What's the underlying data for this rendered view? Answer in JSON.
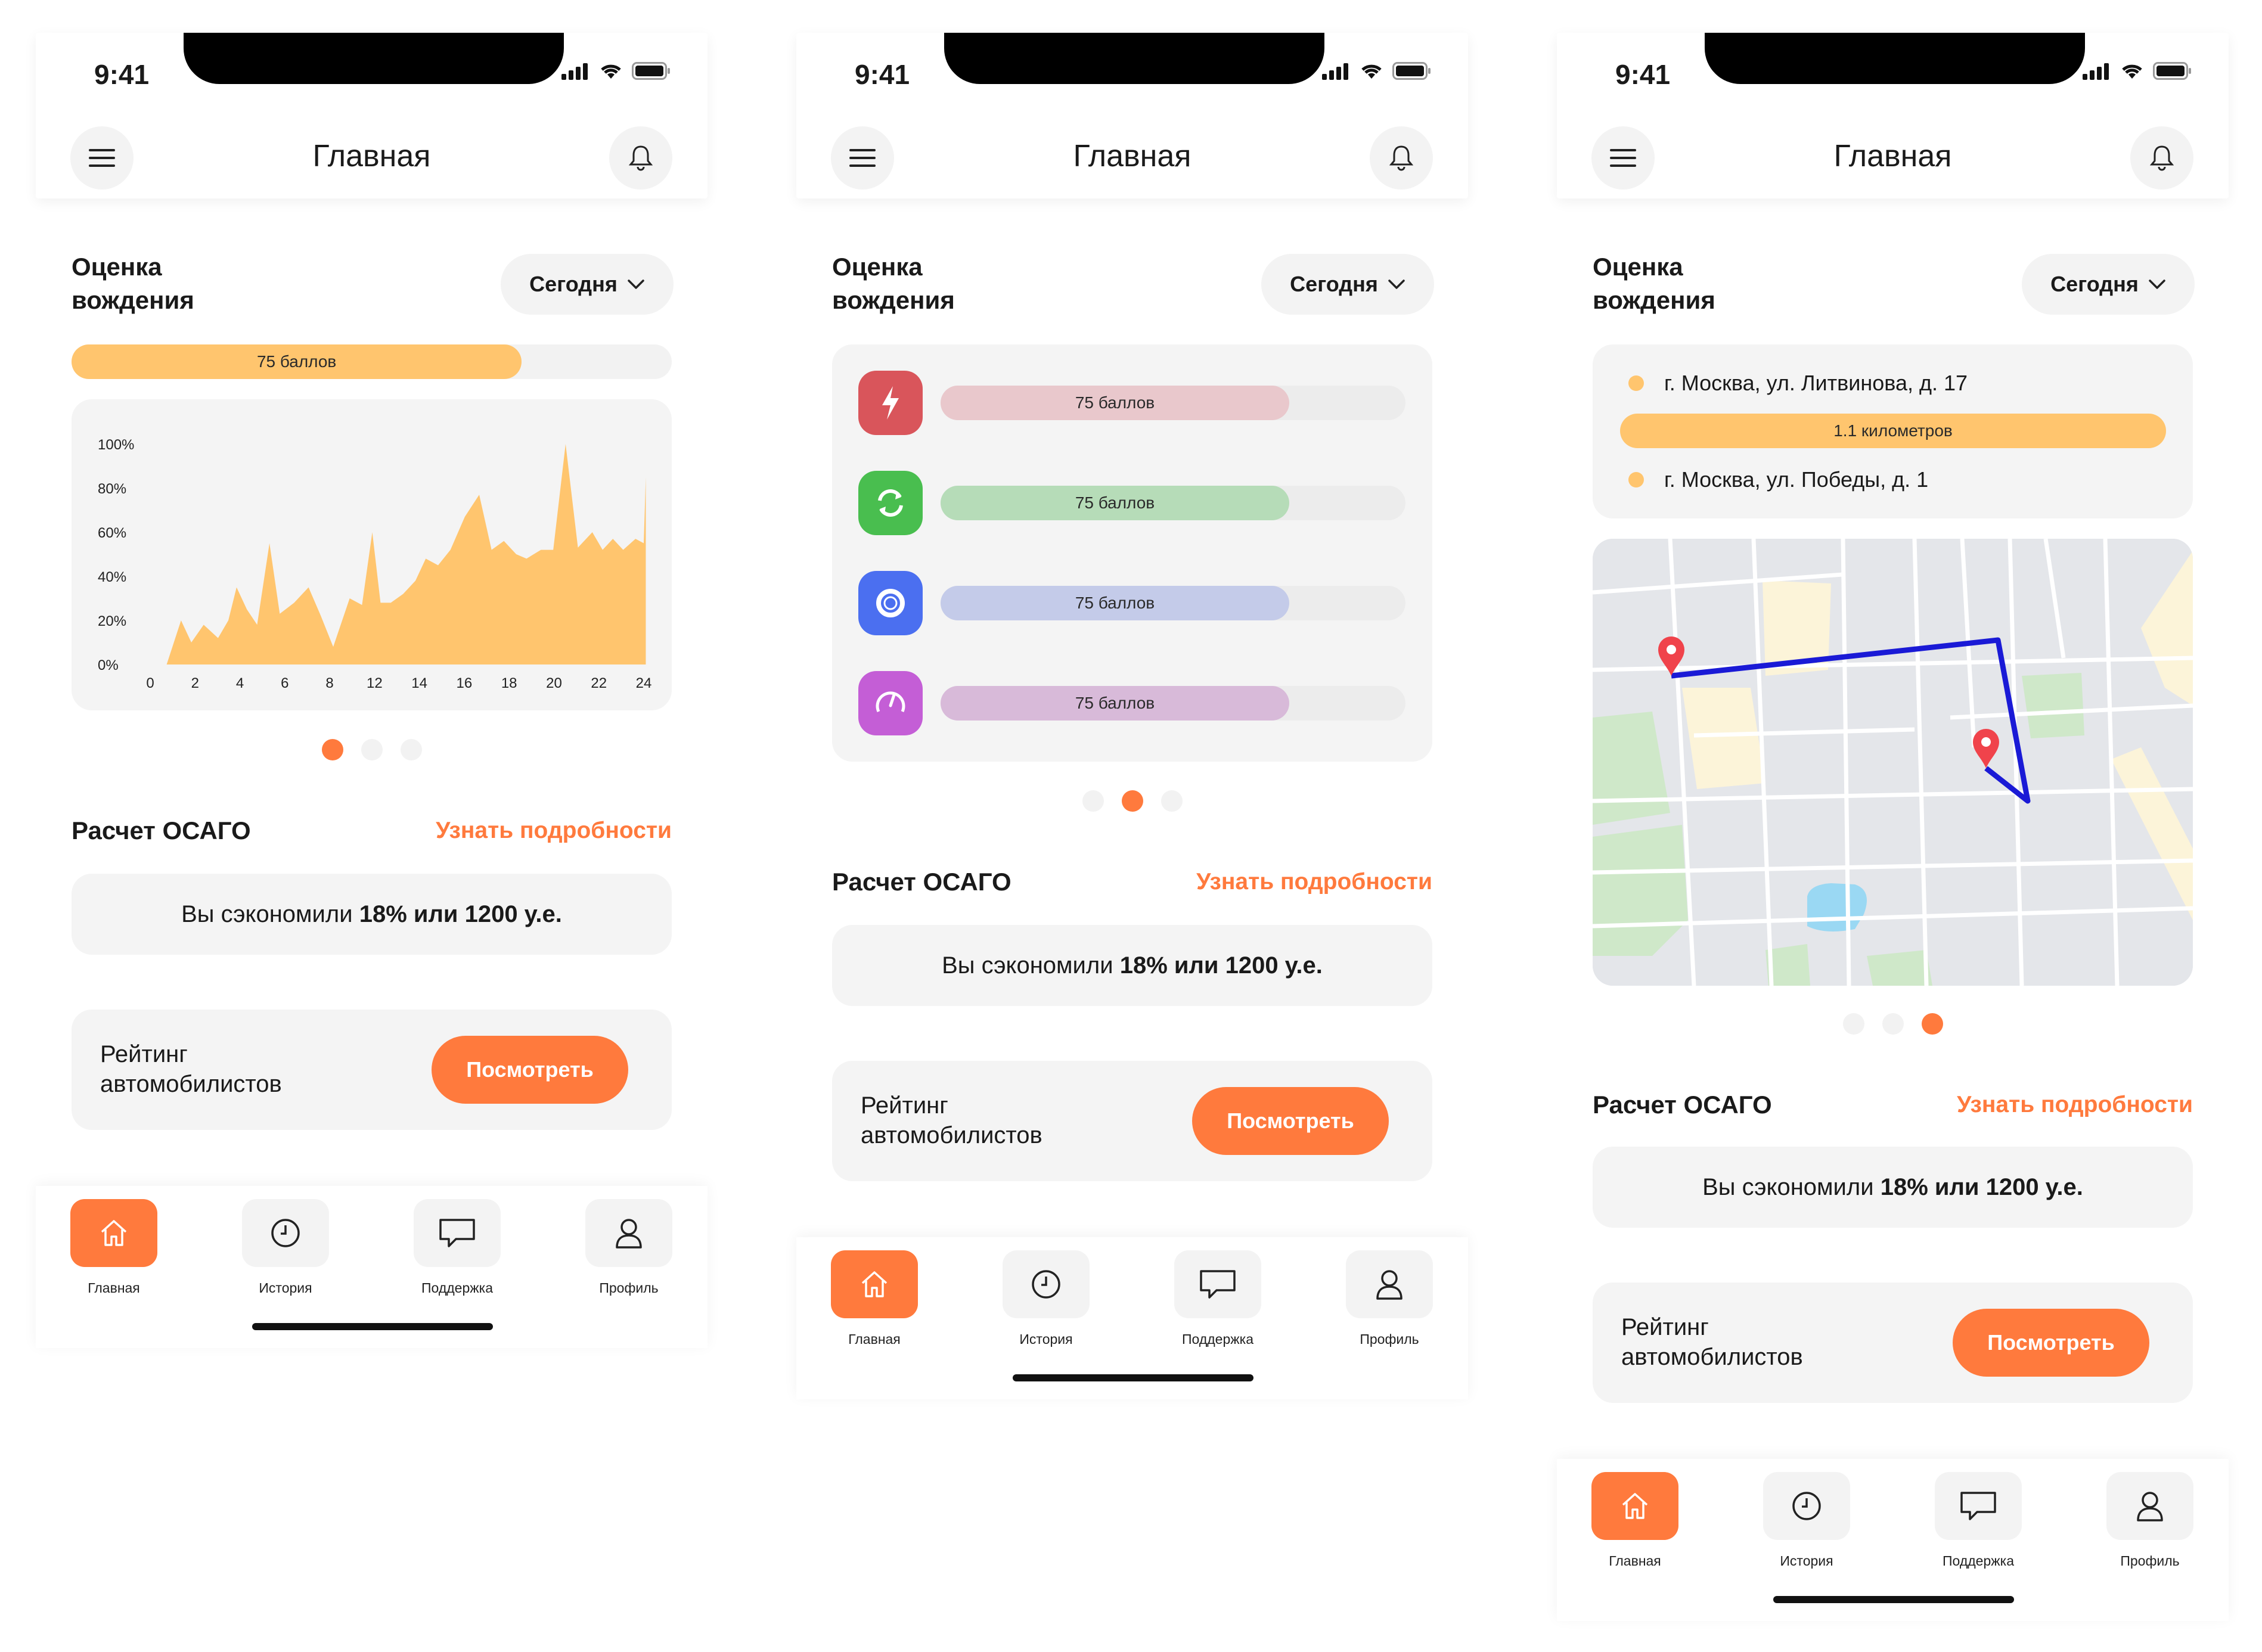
{
  "status": {
    "time": "9:41"
  },
  "header": {
    "title": "Главная"
  },
  "driving": {
    "title_line1": "Оценка",
    "title_line2": "вождения",
    "period": "Сегодня",
    "score_label": "75 баллов",
    "score_pct": 75
  },
  "chart_data": {
    "type": "area",
    "title": "",
    "xlabel": "",
    "ylabel": "",
    "x_ticks": [
      "0",
      "2",
      "4",
      "6",
      "8",
      "12",
      "14",
      "16",
      "18",
      "20",
      "22",
      "24"
    ],
    "y_ticks": [
      "0%",
      "20%",
      "40%",
      "60%",
      "80%",
      "100%"
    ],
    "ylim": [
      0,
      100
    ],
    "xlim": [
      0,
      24
    ],
    "x": [
      0,
      0.8,
      1.5,
      2.0,
      2.6,
      3.3,
      3.8,
      4.2,
      4.7,
      5.2,
      5.8,
      6.3,
      7.0,
      7.7,
      8.3,
      8.9,
      9.7,
      10.3,
      10.8,
      11.2,
      11.7,
      12.3,
      12.9,
      13.4,
      14.0,
      14.6,
      15.3,
      16.0,
      16.6,
      17.2,
      17.8,
      18.3,
      19.0,
      19.6,
      20.2,
      20.8,
      21.5,
      22.0,
      22.5,
      23.0,
      23.6,
      24.0,
      24.1
    ],
    "values": [
      0,
      0,
      20,
      10,
      18,
      12,
      20,
      35,
      25,
      18,
      55,
      23,
      28,
      35,
      22,
      8,
      30,
      27,
      60,
      28,
      28,
      32,
      38,
      48,
      45,
      52,
      67,
      77,
      52,
      56,
      50,
      48,
      52,
      52,
      102,
      53,
      60,
      52,
      57,
      52,
      57,
      55,
      85
    ],
    "fill": "#ffc56e"
  },
  "stats": {
    "items": [
      {
        "label": "75 баллов",
        "pct": 75,
        "icon": "lightning-icon",
        "icon_color": "#d9555b",
        "fill": "#e9c8cc"
      },
      {
        "label": "75 баллов",
        "pct": 75,
        "icon": "refresh-icon",
        "icon_color": "#49be4f",
        "fill": "#b6dcb8"
      },
      {
        "label": "75 баллов",
        "pct": 75,
        "icon": "target-icon",
        "icon_color": "#4b6ff0",
        "fill": "#c4cbe9"
      },
      {
        "label": "75 баллов",
        "pct": 75,
        "icon": "speedometer-icon",
        "icon_color": "#c45ed6",
        "fill": "#d8bad9"
      }
    ]
  },
  "route": {
    "from": "г. Москва, ул. Литвинова, д. 17",
    "distance": "1.1 километров",
    "to": "г. Москва, ул. Победы, д. 1"
  },
  "osago": {
    "title": "Расчет ОСАГО",
    "link": "Узнать подробности",
    "saving_prefix": "Вы сэкономили ",
    "saving_value": "18% или 1200 у.е."
  },
  "rating": {
    "label_line1": "Рейтинг",
    "label_line2": "автомобилистов",
    "button": "Посмотреть"
  },
  "tabs": [
    {
      "label": "Главная",
      "icon": "home-icon",
      "active": true
    },
    {
      "label": "История",
      "icon": "clock-icon",
      "active": false
    },
    {
      "label": "Поддержка",
      "icon": "chat-icon",
      "active": false
    },
    {
      "label": "Профиль",
      "icon": "user-icon",
      "active": false
    }
  ],
  "colors": {
    "accent": "#ff7a3d",
    "score": "#ffc56e",
    "card": "#f4f4f4",
    "route_line": "#1a1ad6",
    "pin": "#f0434b"
  }
}
